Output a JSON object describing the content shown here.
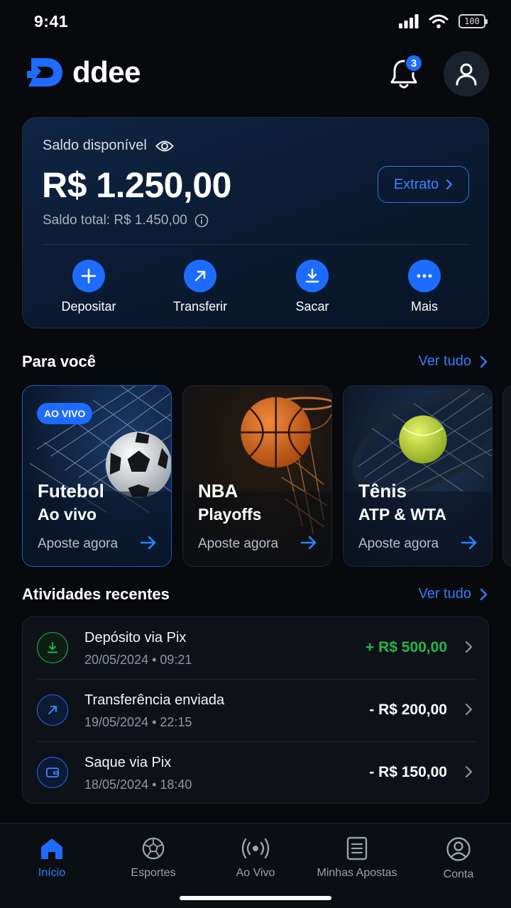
{
  "status_bar": {
    "time": "9:41",
    "battery": "100"
  },
  "header": {
    "brand": "ddee",
    "notification_count": "3",
    "icons": [
      "bell-icon",
      "user-icon"
    ]
  },
  "balance": {
    "label": "Saldo disponível",
    "amount": "R$ 1.250,00",
    "total": "Saldo total: R$ 1.450,00",
    "statement_button": "Extrato",
    "actions": [
      {
        "label": "Depositar",
        "icon": "plus-icon"
      },
      {
        "label": "Transferir",
        "icon": "arrow-up-right-icon"
      },
      {
        "label": "Sacar",
        "icon": "download-icon"
      },
      {
        "label": "Mais",
        "icon": "more-icon"
      }
    ]
  },
  "for_you": {
    "title": "Para você",
    "see_all": "Ver tudo",
    "cards": [
      {
        "badge": "AO VIVO",
        "title": "Futebol",
        "subtitle": "Ao vivo",
        "cta": "Aposte agora"
      },
      {
        "title": "NBA",
        "subtitle": "Playoffs",
        "cta": "Aposte agora"
      },
      {
        "title": "Tênis",
        "subtitle": "ATP & WTA",
        "cta": "Aposte agora"
      }
    ]
  },
  "recent": {
    "title": "Atividades recentes",
    "see_all": "Ver tudo",
    "items": [
      {
        "title": "Depósito via Pix",
        "date": "20/05/2024 • 09:21",
        "amount": "+ R$ 500,00",
        "color": "#22b84a"
      },
      {
        "title": "Transferência enviada",
        "date": "19/05/2024 • 22:15",
        "amount": "- R$ 200,00",
        "color": "#ffffff"
      },
      {
        "title": "Saque via Pix",
        "date": "18/05/2024 • 18:40",
        "amount": "- R$ 150,00",
        "color": "#ffffff"
      }
    ]
  },
  "nav": {
    "items": [
      {
        "label": "Início",
        "icon": "home-icon",
        "active": true
      },
      {
        "label": "Esportes",
        "icon": "ball-icon"
      },
      {
        "label": "Ao Vivo",
        "icon": "live-icon"
      },
      {
        "label": "Minhas Apostas",
        "icon": "document-icon"
      },
      {
        "label": "Conta",
        "icon": "account-icon"
      }
    ]
  },
  "colors": {
    "accent": "#1d6cff",
    "link": "#2f80ff",
    "positive": "#22b84a",
    "background": "#07090d"
  }
}
